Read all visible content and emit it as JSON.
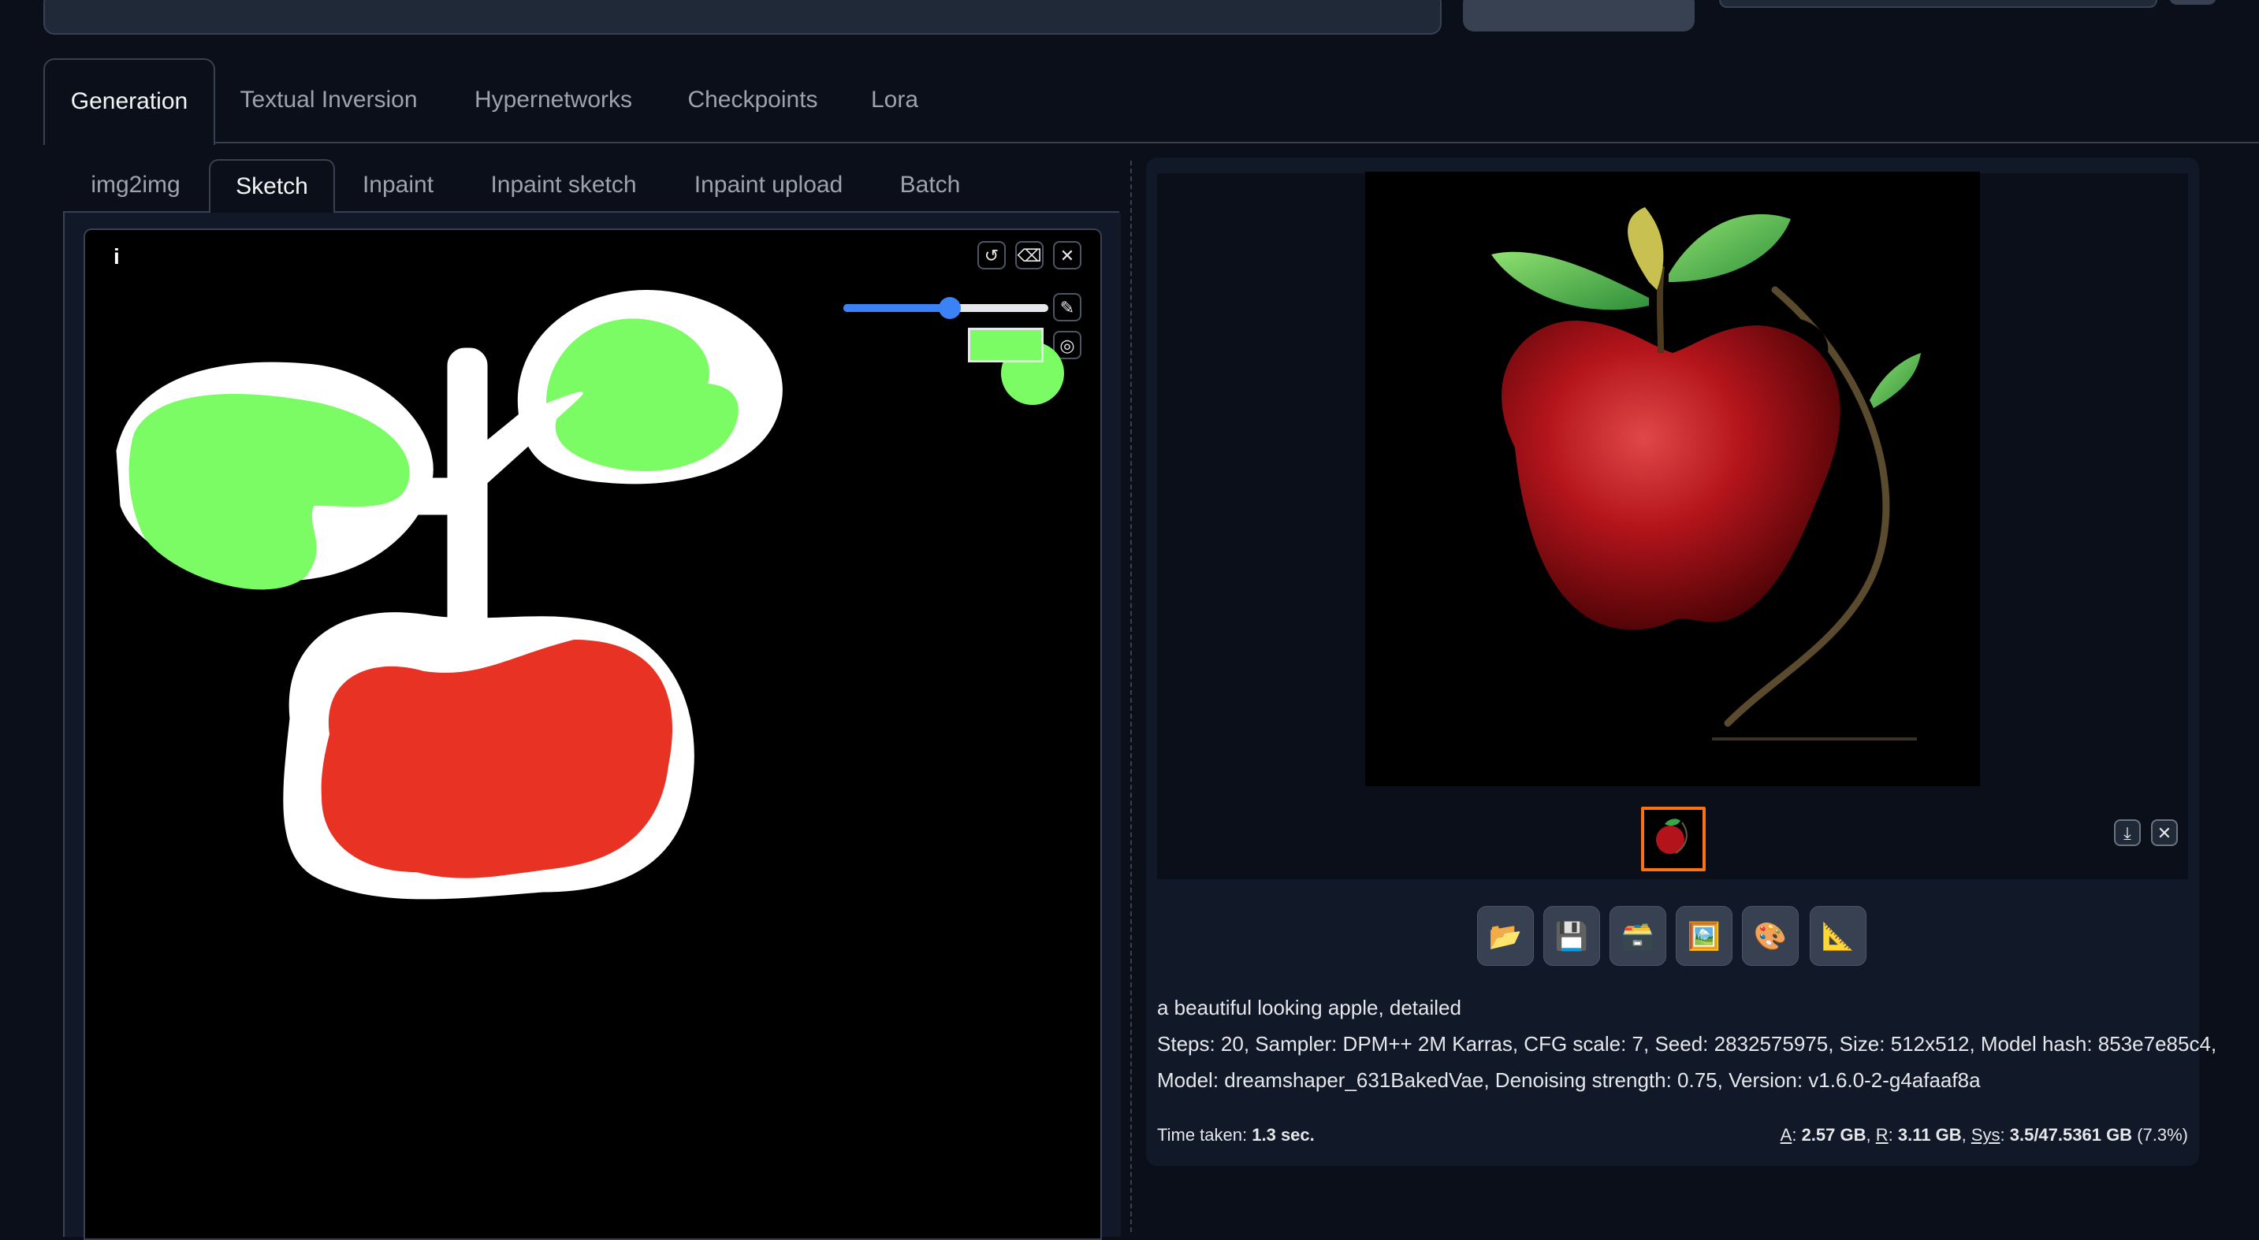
{
  "main_tabs": [
    {
      "label": "Generation",
      "active": true
    },
    {
      "label": "Textual Inversion",
      "active": false
    },
    {
      "label": "Hypernetworks",
      "active": false
    },
    {
      "label": "Checkpoints",
      "active": false
    },
    {
      "label": "Lora",
      "active": false
    }
  ],
  "sub_tabs": [
    {
      "label": "img2img",
      "active": false
    },
    {
      "label": "Sketch",
      "active": true
    },
    {
      "label": "Inpaint",
      "active": false
    },
    {
      "label": "Inpaint sketch",
      "active": false
    },
    {
      "label": "Inpaint upload",
      "active": false
    },
    {
      "label": "Batch",
      "active": false
    }
  ],
  "canvas": {
    "info_label": "i",
    "brush_size_fraction": 0.52,
    "brush_color": "#7cfc64"
  },
  "output": {
    "prompt": "a beautiful looking apple, detailed",
    "params_line1": "Steps: 20, Sampler: DPM++ 2M Karras, CFG scale: 7, Seed: 2832575975, Size: 512x512, Model hash: 853e7e85c4,",
    "params_line2": "Model: dreamshaper_631BakedVae, Denoising strength: 0.75, Version: v1.6.0-2-g4afaaf8a",
    "time_label": "Time taken:",
    "time_value": "1.3 sec.",
    "mem_a_label": "A",
    "mem_a_value": "2.57 GB",
    "mem_r_label": "R",
    "mem_r_value": "3.11 GB",
    "mem_sys_label": "Sys",
    "mem_sys_value": "3.5/47.5361 GB",
    "mem_sys_pct": "(7.3%)"
  },
  "action_buttons": [
    {
      "icon": "folder-icon",
      "glyph": "📂"
    },
    {
      "icon": "save-icon",
      "glyph": "💾"
    },
    {
      "icon": "zip-icon",
      "glyph": "🗃️"
    },
    {
      "icon": "picture-icon",
      "glyph": "🖼️"
    },
    {
      "icon": "palette-icon",
      "glyph": "🎨"
    },
    {
      "icon": "ruler-icon",
      "glyph": "📐"
    }
  ],
  "colors": {
    "background": "#0b0f19",
    "panel": "#111827",
    "accent_orange": "#f97316",
    "slider_blue": "#3b82f6",
    "sketch_green": "#7cfc64",
    "sketch_red": "#e83224"
  }
}
